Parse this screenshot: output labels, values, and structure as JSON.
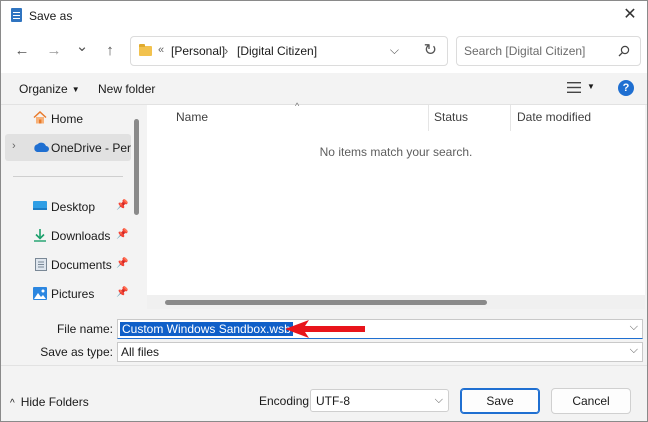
{
  "window": {
    "title": "Save as",
    "close_glyph": "✕"
  },
  "nav": {
    "back_glyph": "←",
    "forward_glyph": "→",
    "recent_glyph": "⌄",
    "up_glyph": "↑",
    "address": {
      "overflow": "«",
      "crumbs": [
        "[Personal]",
        "[Digital Citizen]"
      ],
      "sep": "›",
      "dropdown_glyph": "⌵",
      "refresh_glyph": "↻"
    },
    "search": {
      "placeholder": "Search [Digital Citizen]"
    }
  },
  "commandbar": {
    "organize": "Organize",
    "organize_caret": "▼",
    "new_folder": "New folder",
    "view_caret": "▼",
    "help": "?"
  },
  "sidebar": {
    "items": [
      {
        "label": "Home",
        "icon": "home-icon"
      },
      {
        "label": "OneDrive - Personal",
        "icon": "cloud-icon",
        "expander": "›"
      },
      {
        "label": "Desktop",
        "icon": "desktop-icon",
        "pin": "📌"
      },
      {
        "label": "Downloads",
        "icon": "downloads-icon",
        "pin": "📌"
      },
      {
        "label": "Documents",
        "icon": "documents-icon",
        "pin": "📌"
      },
      {
        "label": "Pictures",
        "icon": "pictures-icon",
        "pin": "📌"
      }
    ]
  },
  "content": {
    "columns": [
      "Name",
      "Status",
      "Date modified"
    ],
    "sort_glyph": "^",
    "empty_message": "No items match your search."
  },
  "fields": {
    "file_name_label": "File name:",
    "file_name_value": "Custom Windows Sandbox.wsb",
    "save_type_label": "Save as type:",
    "save_type_value": "All files",
    "dropdown_glyph": "⌵"
  },
  "footer": {
    "hide_folders": "Hide Folders",
    "hide_glyph": "^",
    "encoding_label": "Encoding:",
    "encoding_value": "UTF-8",
    "save": "Save",
    "cancel": "Cancel"
  },
  "colors": {
    "accent": "#1f6fd1",
    "selection": "#0f5fc8",
    "annotation_arrow": "#e8141b"
  }
}
